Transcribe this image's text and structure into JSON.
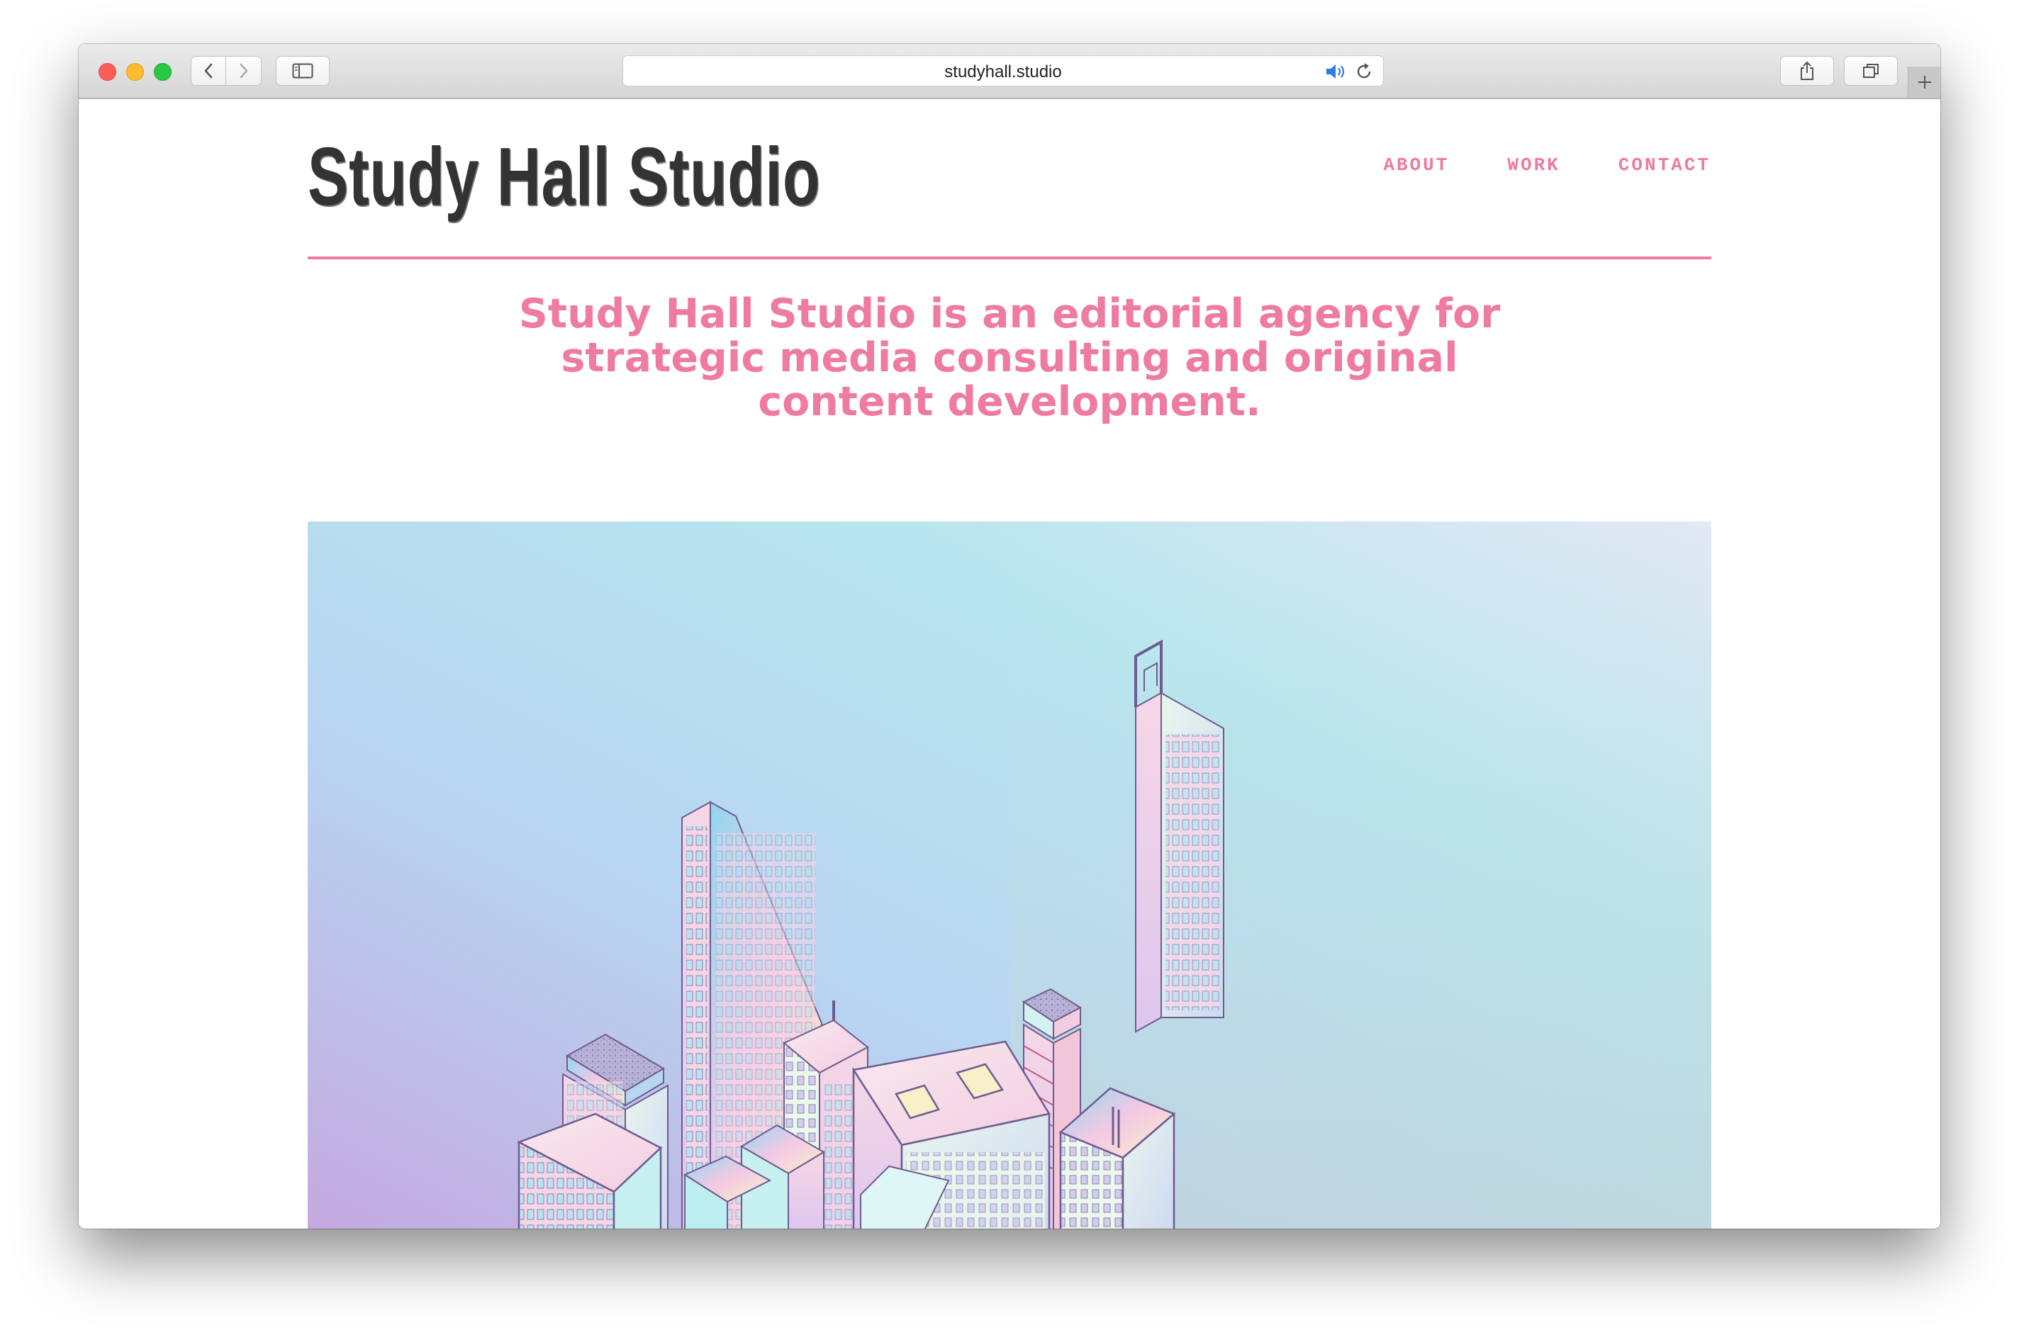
{
  "browser": {
    "url": "studyhall.studio",
    "icons": {
      "back": "chevron-left-icon",
      "forward": "chevron-right-icon",
      "sidebar": "sidebar-icon",
      "audio": "speaker-icon",
      "reload": "reload-icon",
      "share": "share-icon",
      "tabs": "tabs-icon",
      "new_tab": "plus-icon"
    }
  },
  "site": {
    "logo": "Study Hall Studio",
    "nav": [
      "ABOUT",
      "WORK",
      "CONTACT"
    ],
    "tagline": [
      "Study Hall Studio is an editorial agency for",
      "strategic media consulting and original",
      "content development."
    ],
    "hero_image": "isometric-city-illustration"
  },
  "colors": {
    "accent": "#ef7aa2",
    "logo_text": "#333333"
  }
}
